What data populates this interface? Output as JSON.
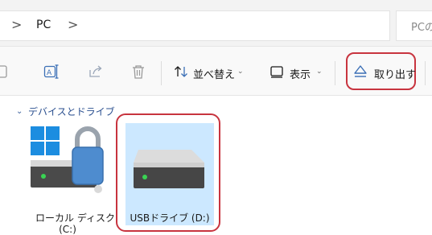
{
  "address": {
    "breadcrumb": [
      ">",
      "PC",
      ">"
    ],
    "search_placeholder": "PCの"
  },
  "toolbar": {
    "sort_label": "並べ替え",
    "view_label": "表示",
    "eject_label": "取り出す"
  },
  "content": {
    "group_title": "デバイスとドライブ",
    "drives": [
      {
        "name": "ローカル ディスク",
        "letter": "(C:)",
        "icon": "locked-system-drive-icon"
      },
      {
        "name": "USBドライブ (D:)",
        "icon": "usb-drive-icon",
        "selected": true
      }
    ]
  },
  "colors": {
    "accent": "#0067c0",
    "selection": "#cce8ff",
    "highlight_outline": "#c8343f"
  }
}
